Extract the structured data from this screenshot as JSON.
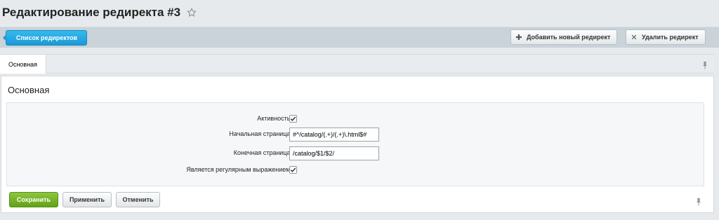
{
  "page": {
    "title": "Редактирование редиректа #3"
  },
  "toolbar": {
    "back_label": "Список редиректов",
    "add_label": "Добавить новый редирект",
    "delete_label": "Удалить редирект"
  },
  "tabs": [
    {
      "label": "Основная",
      "active": true
    }
  ],
  "section": {
    "title": "Основная"
  },
  "form": {
    "active_label": "Активность:",
    "active_checked": true,
    "source_label": "Начальная страница:",
    "source_value": "#^/catalog/(.+)/(.+)\\.html$#",
    "target_label": "Конечная страница:",
    "target_value": "/catalog/$1/$2/",
    "regex_label": "Является регулярным выражением:",
    "regex_checked": true
  },
  "buttons": {
    "save": "Сохранить",
    "apply": "Применить",
    "cancel": "Отменить"
  },
  "colors": {
    "back_button": "#1c9ad6",
    "save_button": "#6aab1e",
    "toolbar_bg": "#c9d3d9"
  }
}
